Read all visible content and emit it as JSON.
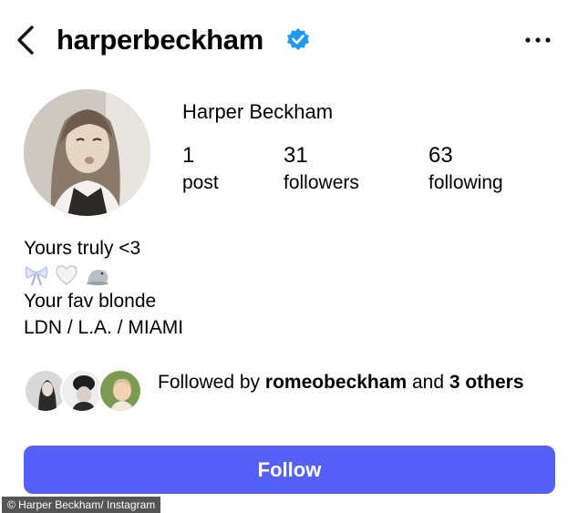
{
  "header": {
    "back_icon": "chevron-left-icon",
    "username": "harperbeckham",
    "verified_icon": "verified-badge-icon",
    "verified_color": "#1d9bf0",
    "more_icon": "more-horizontal-icon"
  },
  "profile": {
    "display_name": "Harper Beckham",
    "stats": [
      {
        "value": "1",
        "label": "post"
      },
      {
        "value": "31",
        "label": "followers"
      },
      {
        "value": "63",
        "label": "following"
      }
    ]
  },
  "bio": {
    "line1": "Yours truly <3",
    "emojis": [
      "ribbon-bow-icon",
      "white-heart-icon",
      "seal-icon"
    ],
    "line3": "Your fav blonde",
    "line4": "LDN / L.A. / MIAMI"
  },
  "followed_by": {
    "prefix": "Followed by ",
    "user": "romeobeckham",
    "middle": " and ",
    "others": "3 others"
  },
  "follow_button": {
    "label": "Follow",
    "color": "#5561f6"
  },
  "credit": "© Harper Beckham/ Instagram"
}
